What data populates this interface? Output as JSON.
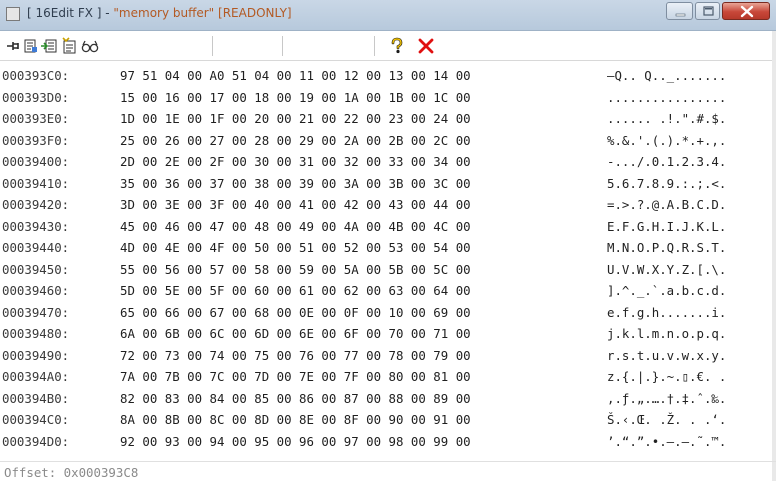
{
  "window": {
    "title_app": "[ 16Edit FX ]",
    "title_sep": " - ",
    "title_doc": "\"memory buffer\" [READONLY]"
  },
  "toolbar": {
    "icons": [
      "pin-icon",
      "list-icon",
      "export-icon",
      "import-icon",
      "find-icon",
      "help-icon",
      "close-file-icon"
    ]
  },
  "rows": [
    {
      "addr": "000393C0:",
      "hex": "97 51 04 00 A0 51 04 00 11 00 12 00 13 00 14 00",
      "ascii": "—Q.. Q.._......."
    },
    {
      "addr": "000393D0:",
      "hex": "15 00 16 00 17 00 18 00 19 00 1A 00 1B 00 1C 00",
      "ascii": "................"
    },
    {
      "addr": "000393E0:",
      "hex": "1D 00 1E 00 1F 00 20 00 21 00 22 00 23 00 24 00",
      "ascii": "...... .!.\".#.$."
    },
    {
      "addr": "000393F0:",
      "hex": "25 00 26 00 27 00 28 00 29 00 2A 00 2B 00 2C 00",
      "ascii": "%.&.'.(.).*.+.,."
    },
    {
      "addr": "00039400:",
      "hex": "2D 00 2E 00 2F 00 30 00 31 00 32 00 33 00 34 00",
      "ascii": "-.../.0.1.2.3.4."
    },
    {
      "addr": "00039410:",
      "hex": "35 00 36 00 37 00 38 00 39 00 3A 00 3B 00 3C 00",
      "ascii": "5.6.7.8.9.:.;.<."
    },
    {
      "addr": "00039420:",
      "hex": "3D 00 3E 00 3F 00 40 00 41 00 42 00 43 00 44 00",
      "ascii": "=.>.?.@.A.B.C.D."
    },
    {
      "addr": "00039430:",
      "hex": "45 00 46 00 47 00 48 00 49 00 4A 00 4B 00 4C 00",
      "ascii": "E.F.G.H.I.J.K.L."
    },
    {
      "addr": "00039440:",
      "hex": "4D 00 4E 00 4F 00 50 00 51 00 52 00 53 00 54 00",
      "ascii": "M.N.O.P.Q.R.S.T."
    },
    {
      "addr": "00039450:",
      "hex": "55 00 56 00 57 00 58 00 59 00 5A 00 5B 00 5C 00",
      "ascii": "U.V.W.X.Y.Z.[.\\."
    },
    {
      "addr": "00039460:",
      "hex": "5D 00 5E 00 5F 00 60 00 61 00 62 00 63 00 64 00",
      "ascii": "].^._.`.a.b.c.d."
    },
    {
      "addr": "00039470:",
      "hex": "65 00 66 00 67 00 68 00 0E 00 0F 00 10 00 69 00",
      "ascii": "e.f.g.h.......i."
    },
    {
      "addr": "00039480:",
      "hex": "6A 00 6B 00 6C 00 6D 00 6E 00 6F 00 70 00 71 00",
      "ascii": "j.k.l.m.n.o.p.q."
    },
    {
      "addr": "00039490:",
      "hex": "72 00 73 00 74 00 75 00 76 00 77 00 78 00 79 00",
      "ascii": "r.s.t.u.v.w.x.y."
    },
    {
      "addr": "000394A0:",
      "hex": "7A 00 7B 00 7C 00 7D 00 7E 00 7F 00 80 00 81 00",
      "ascii": "z.{.|.}.~.▯.€. ."
    },
    {
      "addr": "000394B0:",
      "hex": "82 00 83 00 84 00 85 00 86 00 87 00 88 00 89 00",
      "ascii": "‚.ƒ.„.….†.‡.ˆ.‰."
    },
    {
      "addr": "000394C0:",
      "hex": "8A 00 8B 00 8C 00 8D 00 8E 00 8F 00 90 00 91 00",
      "ascii": "Š.‹.Œ. .Ž. . .‘."
    },
    {
      "addr": "000394D0:",
      "hex": "92 00 93 00 94 00 95 00 96 00 97 00 98 00 99 00",
      "ascii": "’.“.”.•.–.—.˜.™."
    }
  ],
  "status": {
    "offset_text": "Offset: 0x000393C8"
  }
}
